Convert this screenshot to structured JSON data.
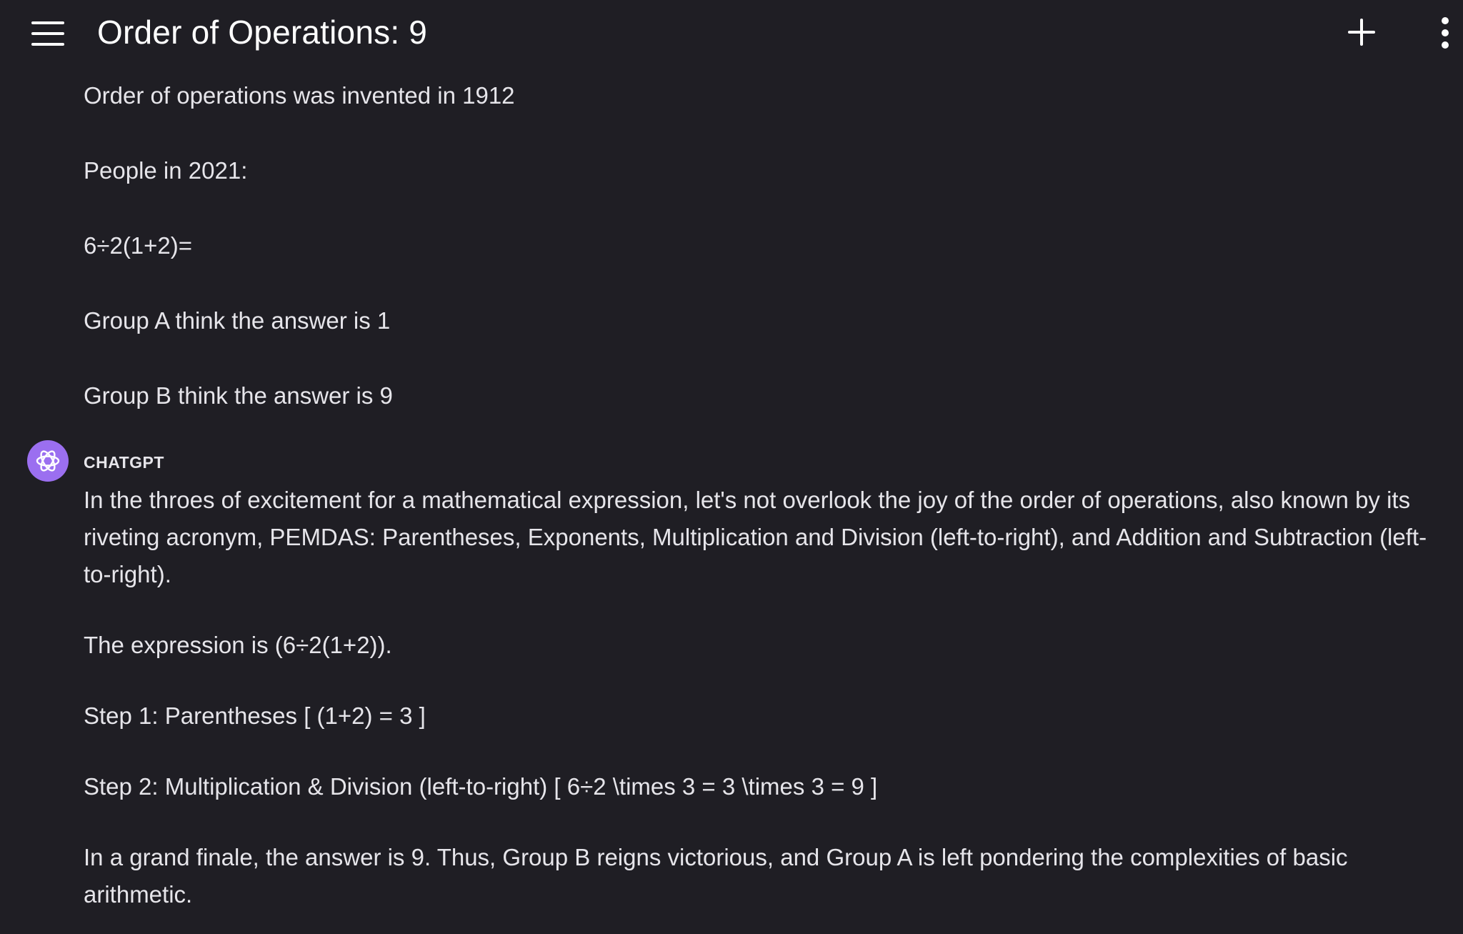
{
  "header": {
    "title": "Order of Operations: 9"
  },
  "user_message": {
    "lines": [
      "Order of operations was invented in 1912",
      "People in 2021:",
      "6÷2(1+2)=",
      "Group A think the answer is 1",
      "Group B think the answer is 9"
    ]
  },
  "assistant_message": {
    "author": "CHATGPT",
    "paragraphs": [
      "In the throes of excitement for a mathematical expression, let's not overlook the joy of the order of operations, also known by its riveting acronym, PEMDAS: Parentheses, Exponents, Multiplication and Division (left-to-right), and Addition and Subtraction (left-to-right).",
      "The expression is (6÷2(1+2)).",
      "Step 1: Parentheses [ (1+2) = 3 ]",
      "Step 2: Multiplication & Division (left-to-right) [ 6÷2 \\times 3 = 3 \\times 3 = 9 ]",
      "In a grand finale, the answer is 9. Thus, Group B reigns victorious, and Group A is left pondering the complexities of basic arithmetic."
    ]
  },
  "icons": {
    "menu": "hamburger-menu-icon",
    "new_chat": "plus-icon",
    "more": "more-vertical-icon",
    "avatar": "openai-logo-icon"
  },
  "colors": {
    "background": "#1f1e24",
    "text": "#e6e5ea",
    "avatar": "#9b6ff0"
  }
}
